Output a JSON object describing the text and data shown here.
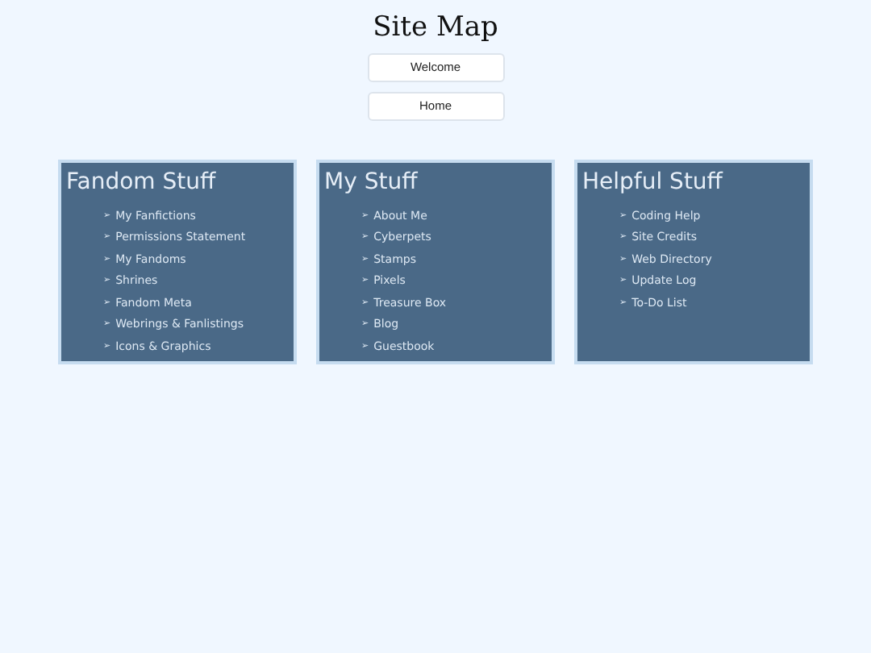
{
  "title": "Site Map",
  "buttons": [
    "Welcome",
    "Home"
  ],
  "sections": [
    {
      "heading": "Fandom Stuff",
      "links": [
        {
          "marker": "➢",
          "label": "My Fanfictions"
        },
        {
          "marker": "➢",
          "label": "Permissions Statement"
        },
        {
          "marker": "➢",
          "label": "My Fandoms"
        },
        {
          "marker": "➢",
          "label": "Shrines"
        },
        {
          "marker": "➢",
          "label": "Fandom Meta"
        },
        {
          "marker": "➢",
          "label": "Webrings & Fanlistings"
        },
        {
          "marker": "➢",
          "label": "Icons & Graphics"
        }
      ]
    },
    {
      "heading": "My Stuff",
      "links": [
        {
          "marker": "➢",
          "label": "About Me"
        },
        {
          "marker": "➢",
          "label": "Cyberpets"
        },
        {
          "marker": "➢",
          "label": "Stamps"
        },
        {
          "marker": "➢",
          "label": "Pixels"
        },
        {
          "marker": "➢",
          "label": "Treasure Box"
        },
        {
          "marker": "➢",
          "label": "Blog"
        },
        {
          "marker": "➢",
          "label": "Guestbook"
        }
      ]
    },
    {
      "heading": "Helpful Stuff",
      "links": [
        {
          "marker": "➢",
          "label": "Coding Help"
        },
        {
          "marker": "➢",
          "label": "Site Credits"
        },
        {
          "marker": "➢",
          "label": "Web Directory"
        },
        {
          "marker": "➢",
          "label": "Update Log"
        },
        {
          "marker": "➢",
          "label": "To-Do List"
        }
      ]
    }
  ]
}
